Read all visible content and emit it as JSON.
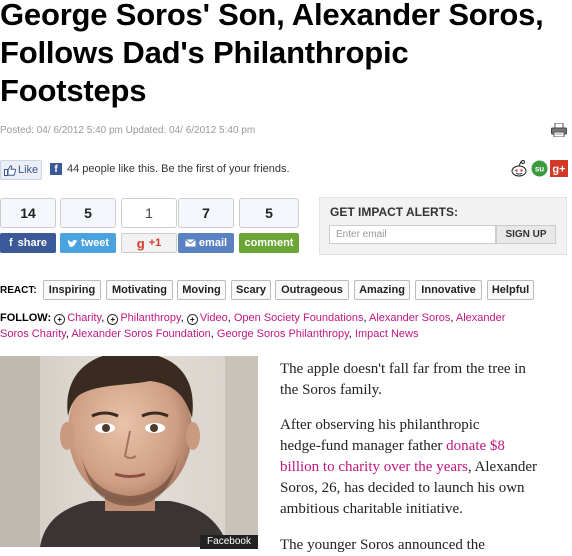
{
  "headline": {
    "line1": "George Soros' Son, Alexander Soros,",
    "line2": "Follows Dad's Philanthropic",
    "line3": "Footsteps"
  },
  "posted": "Posted: 04/ 6/2012 5:40 pm Updated: 04/ 6/2012 5:40 pm",
  "facebook": {
    "like_label": "Like",
    "count_text": "44 people like this. Be the first of your friends."
  },
  "share": {
    "facebook": {
      "count": "14",
      "label": "share",
      "color": "#3b5998"
    },
    "twitter": {
      "count": "5",
      "label": "tweet",
      "color": "#4aa3df"
    },
    "google": {
      "count": "1",
      "label": "+1"
    },
    "email": {
      "count": "7",
      "label": "email",
      "color": "#5a82c2"
    },
    "comment": {
      "count": "5",
      "label": "comment",
      "color": "#6aa535"
    }
  },
  "alerts": {
    "title": "GET IMPACT ALERTS:",
    "placeholder": "Enter email",
    "signup_label": "SIGN UP"
  },
  "react": {
    "label": "REACT:",
    "options": [
      "Inspiring",
      "Motivating",
      "Moving",
      "Scary",
      "Outrageous",
      "Amazing",
      "Innovative",
      "Helpful"
    ]
  },
  "follow": {
    "label": "FOLLOW:",
    "topics": [
      "Charity",
      "Philanthropy",
      "Video"
    ],
    "tags_line1": [
      "Open Society Foundations",
      "Alexander Soros",
      "Alexander"
    ],
    "tags_line2": [
      "Soros Charity",
      "Alexander Soros Foundation",
      "George Soros Philanthropy",
      "Impact News"
    ]
  },
  "photo": {
    "credit": "Facebook"
  },
  "article": {
    "p1_line1": "The apple doesn't fall far from the tree in",
    "p1_line2": "the Soros family.",
    "p2_line1": "After observing his philanthropic",
    "p2_line2_before": "hedge-fund manager father ",
    "p2_link1": "donate $8",
    "p2_link2": "billion to charity over the years",
    "p2_line3_after": ", Alexander",
    "p2_line4": "Soros, 26, has decided to launch his own",
    "p2_line5": "ambitious charitable initiative.",
    "p3_line1": "The younger Soros announced the"
  }
}
